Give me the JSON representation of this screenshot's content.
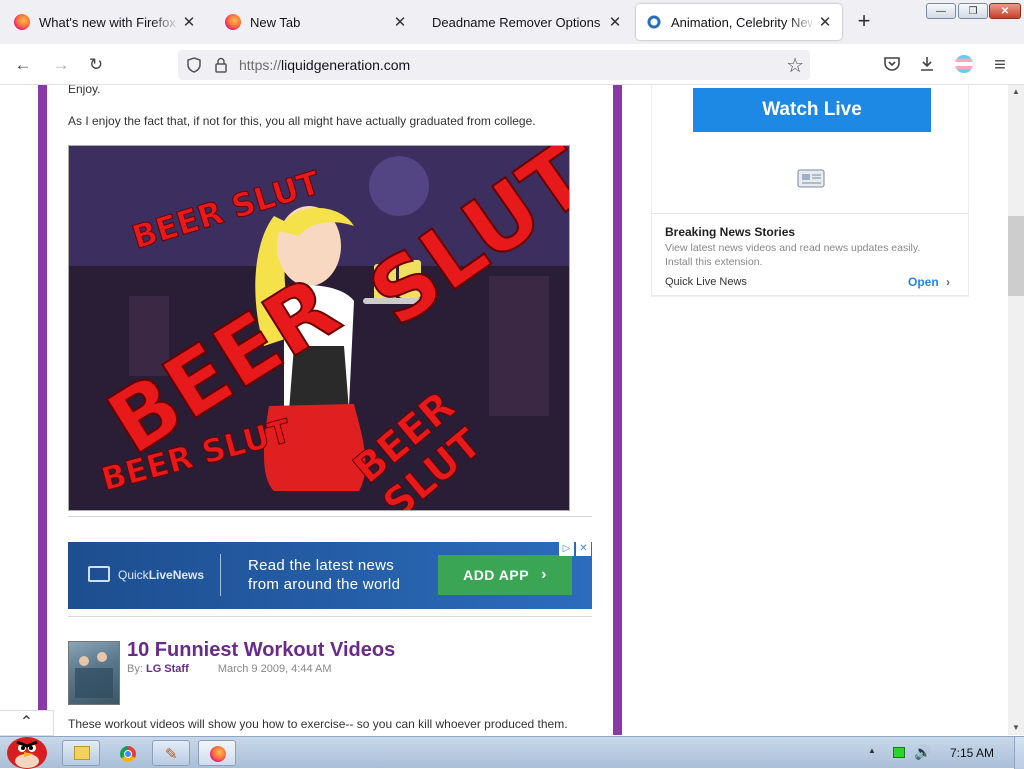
{
  "tabs": [
    {
      "title": "What's new with Firefox - Mo",
      "close": "✕"
    },
    {
      "title": "New Tab",
      "close": "✕"
    },
    {
      "title": "Deadname Remover Options",
      "close": "✕"
    },
    {
      "title": "Animation, Celebrity News, C",
      "close": "✕"
    }
  ],
  "new_tab_symbol": "+",
  "window_controls": {
    "minimize": "—",
    "maximize": "❐",
    "close": "✕"
  },
  "nav": {
    "back": "←",
    "forward": "→",
    "reload": "↻"
  },
  "url": {
    "scheme": "https://",
    "host": "liquidgeneration.com"
  },
  "icons": {
    "bookmark": "☆",
    "pocket": "⌂",
    "download": "⤓",
    "menu": "≡",
    "lock": "🔒",
    "shield": "⛉"
  },
  "content": {
    "enjoy": "Enjoy.",
    "intro": "As I enjoy the fact that, if not for this, you all might have actually graduated from college.",
    "image_text": {
      "t1": "BEER SLUT",
      "t2": "SLUT",
      "t3": "BEER",
      "t4": "BEER SLUT",
      "t5": "BEER SLUT"
    },
    "ad": {
      "brand_plain": "Quick",
      "brand_bold": "LiveNews",
      "line1": "Read the latest news",
      "line2": "from around the world",
      "button": "ADD APP",
      "button_arrow": "›",
      "close": "✕"
    },
    "article": {
      "title": "10 Funniest Workout Videos",
      "by": "By:",
      "author": "LG Staff",
      "date": "March 9 2009, 4:44 AM",
      "snippet": "These workout videos will show you how to exercise-- so you can kill whoever produced them."
    }
  },
  "sidebar": {
    "watch_live": "Watch Live",
    "breaking": {
      "title": "Breaking News Stories",
      "desc1": "View latest news videos and read news updates easily.",
      "desc2": "Install this extension.",
      "source": "Quick Live News",
      "open": "Open",
      "open_arrow": "›"
    }
  },
  "scroll": {
    "up": "▲",
    "down": "▼",
    "to_top": "⌃"
  },
  "taskbar": {
    "time": "7:15 AM",
    "tray_up": "▲"
  },
  "colors": {
    "purple_border": "#8a3aa6",
    "title_purple": "#6a2a8a",
    "watch_blue": "#1e88e5",
    "ad_green": "#3aa655"
  }
}
